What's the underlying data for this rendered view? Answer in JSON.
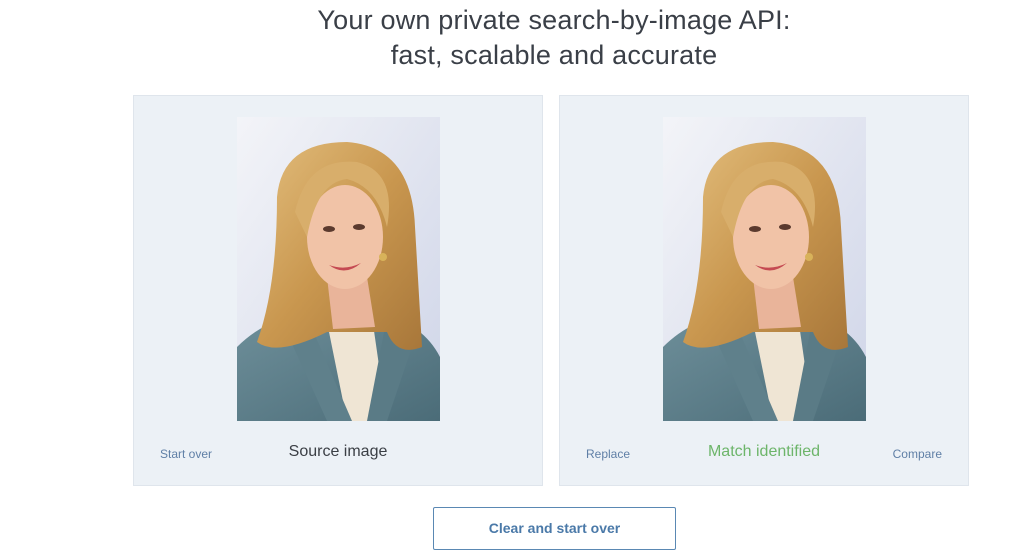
{
  "headline": {
    "line1": "Your own private search-by-image API:",
    "line2": "fast, scalable and accurate"
  },
  "source_panel": {
    "left_link": "Start over",
    "label": "Source image"
  },
  "match_panel": {
    "left_link": "Replace",
    "label": "Match identified",
    "right_link": "Compare",
    "label_color": "#6db56a"
  },
  "clear_button": {
    "label": "Clear and start over"
  },
  "colors": {
    "panel_bg": "#ecf1f6",
    "link": "#5f7fa6",
    "button_border": "#5a88b3"
  }
}
